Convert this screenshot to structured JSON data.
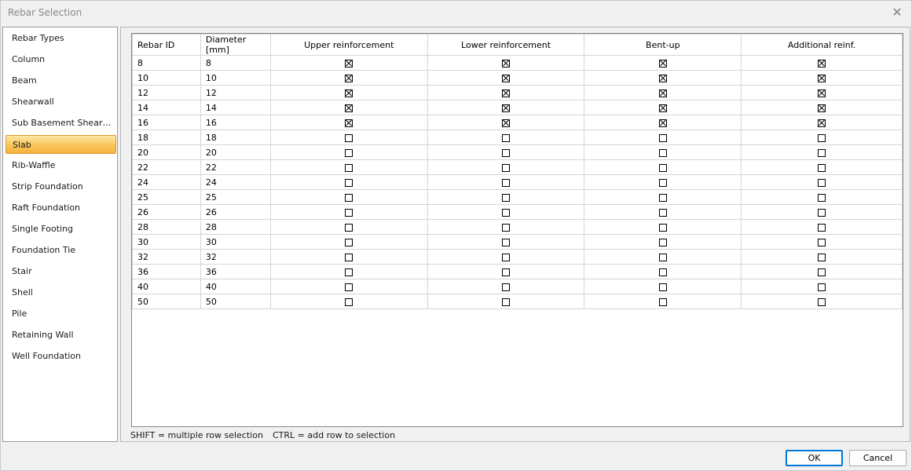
{
  "window": {
    "title": "Rebar Selection"
  },
  "sidebar": {
    "items": [
      {
        "label": "Rebar Types",
        "selected": false
      },
      {
        "label": "Column",
        "selected": false
      },
      {
        "label": "Beam",
        "selected": false
      },
      {
        "label": "Shearwall",
        "selected": false
      },
      {
        "label": "Sub Basement Shearw...",
        "selected": false
      },
      {
        "label": "Slab",
        "selected": true
      },
      {
        "label": "Rib-Waffle",
        "selected": false
      },
      {
        "label": "Strip Foundation",
        "selected": false
      },
      {
        "label": "Raft Foundation",
        "selected": false
      },
      {
        "label": "Single Footing",
        "selected": false
      },
      {
        "label": "Foundation Tie",
        "selected": false
      },
      {
        "label": "Stair",
        "selected": false
      },
      {
        "label": "Shell",
        "selected": false
      },
      {
        "label": "Pile",
        "selected": false
      },
      {
        "label": "Retaining Wall",
        "selected": false
      },
      {
        "label": "Well Foundation",
        "selected": false
      }
    ]
  },
  "table": {
    "columns": [
      "Rebar ID",
      "Diameter [mm]",
      "Upper reinforcement",
      "Lower reinforcement",
      "Bent-up",
      "Additional reinf."
    ],
    "rows": [
      {
        "id": "8",
        "diameter": "8",
        "checks": [
          true,
          true,
          true,
          true
        ]
      },
      {
        "id": "10",
        "diameter": "10",
        "checks": [
          true,
          true,
          true,
          true
        ]
      },
      {
        "id": "12",
        "diameter": "12",
        "checks": [
          true,
          true,
          true,
          true
        ]
      },
      {
        "id": "14",
        "diameter": "14",
        "checks": [
          true,
          true,
          true,
          true
        ]
      },
      {
        "id": "16",
        "diameter": "16",
        "checks": [
          true,
          true,
          true,
          true
        ]
      },
      {
        "id": "18",
        "diameter": "18",
        "checks": [
          false,
          false,
          false,
          false
        ]
      },
      {
        "id": "20",
        "diameter": "20",
        "checks": [
          false,
          false,
          false,
          false
        ]
      },
      {
        "id": "22",
        "diameter": "22",
        "checks": [
          false,
          false,
          false,
          false
        ]
      },
      {
        "id": "24",
        "diameter": "24",
        "checks": [
          false,
          false,
          false,
          false
        ]
      },
      {
        "id": "25",
        "diameter": "25",
        "checks": [
          false,
          false,
          false,
          false
        ]
      },
      {
        "id": "26",
        "diameter": "26",
        "checks": [
          false,
          false,
          false,
          false
        ]
      },
      {
        "id": "28",
        "diameter": "28",
        "checks": [
          false,
          false,
          false,
          false
        ]
      },
      {
        "id": "30",
        "diameter": "30",
        "checks": [
          false,
          false,
          false,
          false
        ]
      },
      {
        "id": "32",
        "diameter": "32",
        "checks": [
          false,
          false,
          false,
          false
        ]
      },
      {
        "id": "36",
        "diameter": "36",
        "checks": [
          false,
          false,
          false,
          false
        ]
      },
      {
        "id": "40",
        "diameter": "40",
        "checks": [
          false,
          false,
          false,
          false
        ]
      },
      {
        "id": "50",
        "diameter": "50",
        "checks": [
          false,
          false,
          false,
          false
        ]
      }
    ]
  },
  "hints": {
    "shift": "SHIFT = multiple row selection",
    "ctrl": "CTRL = add row to selection"
  },
  "buttons": {
    "ok": "OK",
    "cancel": "Cancel"
  },
  "icons": {
    "close": "close-icon"
  }
}
